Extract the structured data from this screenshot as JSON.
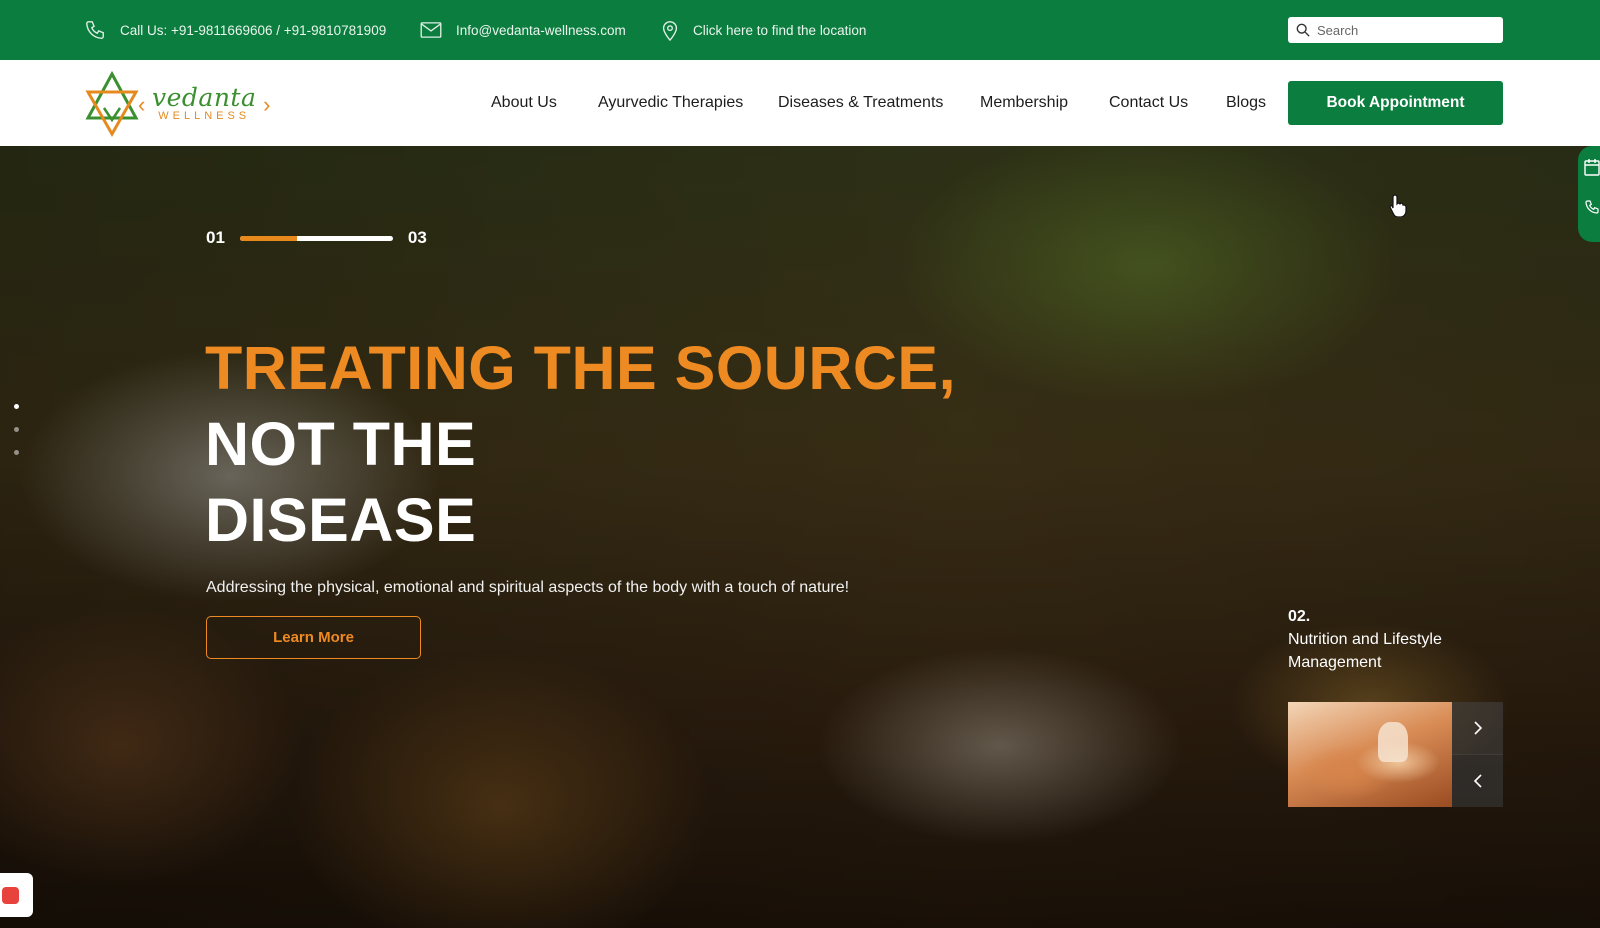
{
  "topbar": {
    "phone": "Call Us: +91-9811669606 /  +91-9810781909",
    "email": "Info@vedanta-wellness.com",
    "location": "Click here to find the location",
    "search_placeholder": "Search"
  },
  "logo": {
    "name": "vedanta",
    "subtitle": "WELLNESS"
  },
  "nav": {
    "items": [
      "About Us",
      "Ayurvedic Therapies",
      "Diseases & Treatments",
      "Membership",
      "Contact Us",
      "Blogs"
    ],
    "book_label": "Book Appointment"
  },
  "hero": {
    "slide_current": "01",
    "slide_total": "03",
    "slide_progress": 0.37,
    "title_line1": "TREATING THE SOURCE,",
    "title_line2": "NOT THE",
    "title_line3": "DISEASE",
    "subtitle": "Addressing the physical, emotional and spiritual aspects of the body with a touch of nature!",
    "cta": "Learn More",
    "next_slide_number": "02.",
    "next_slide_title": "Nutrition and Lifestyle Management"
  },
  "colors": {
    "brand_green": "#0b7d3e",
    "accent_orange": "#ee8a22"
  },
  "icons": [
    "phone-icon",
    "mail-icon",
    "location-pin-icon",
    "search-icon",
    "calendar-icon",
    "chevron-right-icon",
    "chevron-left-icon"
  ]
}
